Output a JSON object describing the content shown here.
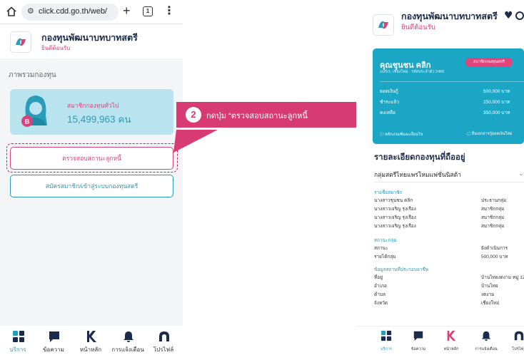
{
  "colors": {
    "brand_pink": "#d4447a",
    "brand_teal": "#2a9bb8",
    "navy": "#1d2b4b",
    "card_light": "#b9e3ef",
    "callout": "#d83a72"
  },
  "browser": {
    "url": "click.cdd.go.th/web/",
    "tab_count": "1",
    "icons": [
      "home-icon",
      "tune-icon",
      "plus-icon",
      "tabs-icon",
      "kebab-menu-icon"
    ]
  },
  "left": {
    "app_title": "กองทุนพัฒนาบทบาทสตรี",
    "app_subtitle": "ยินดีต้อนรับ",
    "section_label": "ภาพรวมกองทุน",
    "member_card": {
      "label": "สมาชิกกองทุนทั่วไป",
      "count": "15,499,963 คน"
    },
    "buttons": {
      "check_debt": "ตรวจสอบสถานะลูกหนี้",
      "register": "สมัครสมาชิก/เข้าสู่ระบบกองทุนสตรี"
    }
  },
  "callout": {
    "step": "2",
    "text": "กดปุ่ม “ตรวจสอบสถานะลูกหนี้"
  },
  "bottom_nav": [
    {
      "label": "บริการ",
      "icon": "grid-icon",
      "active": true
    },
    {
      "label": "ข้อความ",
      "icon": "chat-icon",
      "active": false
    },
    {
      "label": "หน้าหลัก",
      "icon": "home-k-icon",
      "active": false
    },
    {
      "label": "การแจ้งเตือน",
      "icon": "bell-icon",
      "active": false
    },
    {
      "label": "โปรไฟล์",
      "icon": "profile-icon",
      "active": false
    }
  ],
  "right": {
    "app_title": "กองทุนพัฒนาบทบาทสตรี",
    "app_subtitle": "ยินดีต้อนรับ",
    "account": {
      "name": "คุณชุนชน คลิก",
      "meta": "แปร์เร, เชียงใหม่ · รหัสประจำตัว 2466",
      "badge": "สมาชิกกองทุนสตรี",
      "rows": [
        {
          "label": "ยอดเงินกู้",
          "value": "500,000 บาท"
        },
        {
          "label": "ชำระแล้ว",
          "value": "250,000 บาท"
        },
        {
          "label": "คงเหลือ",
          "value": "350,000 บาท"
        }
      ],
      "footer_left": "หลักเกณฑ์และเงื่อนไข",
      "footer_right": "ยื่นเอกสารกู้ยอดเงินใหม่"
    },
    "section_title": "รายละเอียดกองทุนที่ถืออยู่",
    "group_name": "กลุ่มสตรีไทยแพร่โหมแฟชั่นนิสต้า",
    "members_header": "รายชื่อสมาชิก",
    "members": [
      {
        "name": "นางสาวชุนชน คลิก",
        "role": "ประธานกลุ่ม"
      },
      {
        "name": "นางสาวเจริญ รุ่งเรือง",
        "role": "สมาชิกกลุ่ม"
      },
      {
        "name": "นางสาวเจริญ รุ่งเรือง",
        "role": "สมาชิกกลุ่ม"
      },
      {
        "name": "นางสาวเจริญ รุ่งเรือง",
        "role": "สมาชิกกลุ่ม"
      }
    ],
    "status_header": "สถานะกลุ่ม",
    "status_rows": [
      {
        "label": "สถานะ",
        "value": "ยังดำเนินการ"
      },
      {
        "label": "รายได้กลุ่ม",
        "value": "500,000 บาท"
      }
    ],
    "business_header": "ข้อมูลสถานที่ประกอบอาชีพ",
    "business_rows": [
      {
        "label": "ที่อยู่",
        "value": "บ้านไทยงดงาม หมู่ 12"
      },
      {
        "label": "อำเภอ",
        "value": "บ้านไทย"
      },
      {
        "label": "ตำบล",
        "value": "งดงาม"
      },
      {
        "label": "จังหวัด",
        "value": "เชียงใหม่"
      }
    ]
  }
}
